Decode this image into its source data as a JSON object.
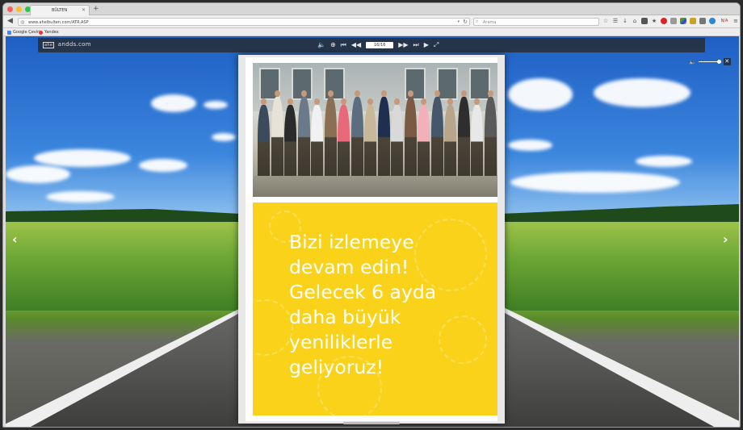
{
  "browser": {
    "tab_title": "BÜLTEN",
    "url": "www.ahelbulten.com/ATR.ASP",
    "search_placeholder": "Arama",
    "bookmarks": [
      "Google Çeviri",
      "Yandex"
    ],
    "toolbar_text": "N/A"
  },
  "flipbook": {
    "logo_box": "ahe",
    "logo_text": "andds.com",
    "page_indicator": "16/16",
    "icons": [
      "volume-icon",
      "zoom-icon",
      "first-page-icon",
      "prev-page-icon",
      "next-page-icon",
      "last-page-icon",
      "play-icon",
      "fullscreen-icon"
    ]
  },
  "page": {
    "message": "Bizi izlemeye\ndevam edin!\nGelecek 6 ayda\ndaha büyük\nyeniliklerle\ngeliyoruz!"
  },
  "colors": {
    "accent_yellow": "#fbd21a",
    "toolbar": "#282828"
  }
}
